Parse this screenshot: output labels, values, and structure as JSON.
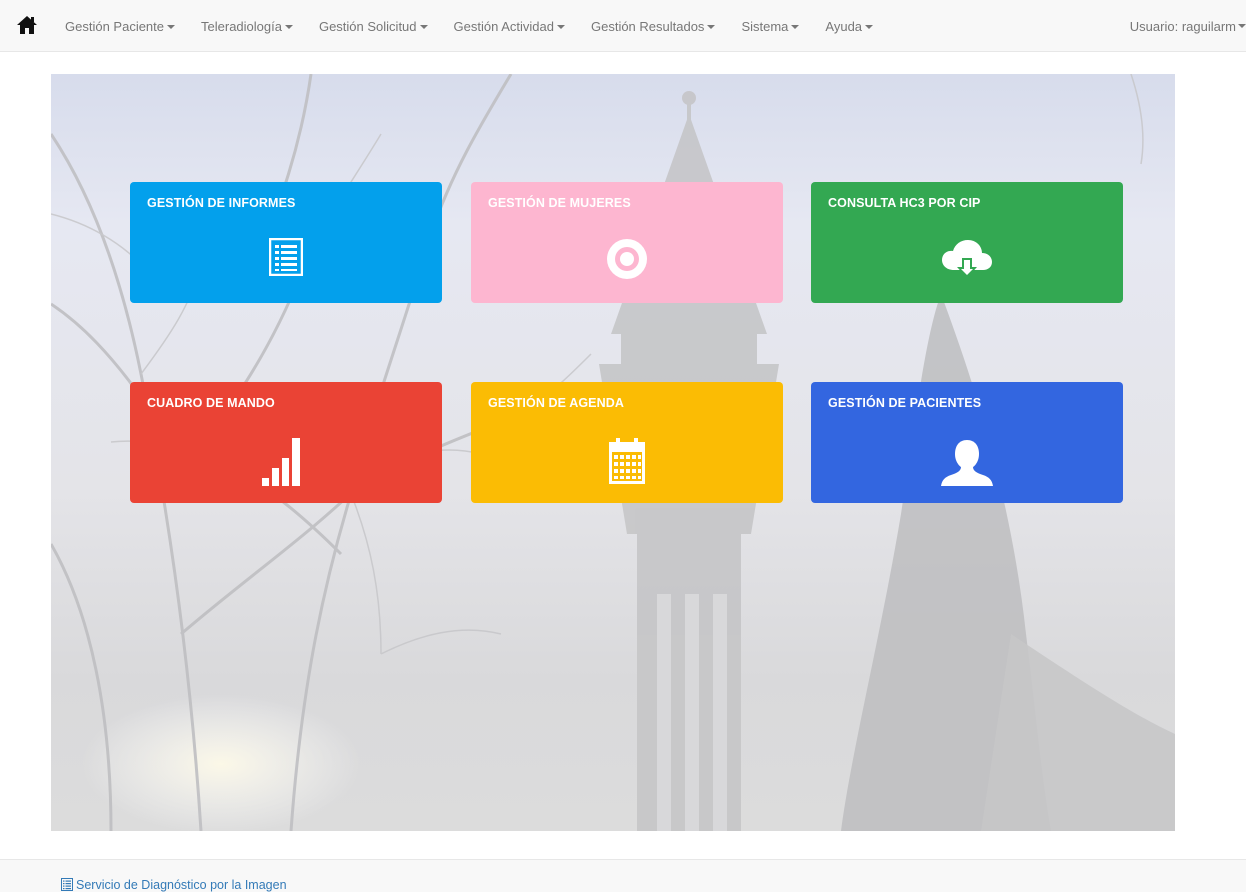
{
  "navbar": {
    "home_icon": "home-icon",
    "menu": [
      {
        "label": "Gestión Paciente"
      },
      {
        "label": "Teleradiología"
      },
      {
        "label": "Gestión Solicitud"
      },
      {
        "label": "Gestión Actividad"
      },
      {
        "label": "Gestión Resultados"
      },
      {
        "label": "Sistema"
      },
      {
        "label": "Ayuda"
      }
    ],
    "user_label": "Usuario: raguilarm"
  },
  "tiles": [
    {
      "title": "GESTIÓN DE INFORMES",
      "icon": "list-document-icon",
      "color": "#03a0ec"
    },
    {
      "title": "GESTIÓN DE MUJERES",
      "icon": "target-ring-icon",
      "color": "#fdb6d0"
    },
    {
      "title": "CONSULTA HC3 POR CIP",
      "icon": "cloud-download-icon",
      "color": "#33a852"
    },
    {
      "title": "CUADRO DE MANDO",
      "icon": "signal-bars-icon",
      "color": "#ea4335"
    },
    {
      "title": "GESTIÓN DE AGENDA",
      "icon": "calendar-icon",
      "color": "#fbbc04"
    },
    {
      "title": "GESTIÓN DE PACIENTES",
      "icon": "user-icon",
      "color": "#3366e0"
    }
  ],
  "footer": {
    "link_label": "Servicio de Diagnóstico por la Imagen",
    "link_icon": "list-document-icon"
  }
}
